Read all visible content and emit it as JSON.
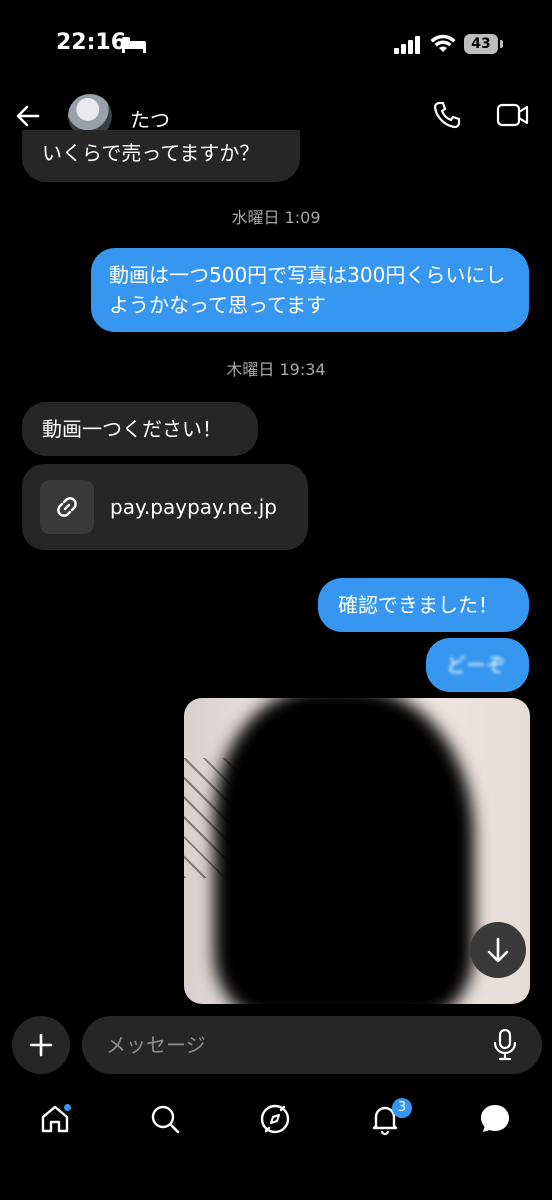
{
  "status_bar": {
    "time": "22:16",
    "battery": "43"
  },
  "header": {
    "contact_name": "たつ"
  },
  "messages": [
    {
      "direction": "in",
      "text": "いくらで売ってますか？"
    },
    {
      "direction": "out",
      "text": "動画は一つ500円で写真は300円くらいにしようかなって思ってます"
    },
    {
      "direction": "in",
      "text": "動画一つください！"
    },
    {
      "direction": "in",
      "type": "link",
      "text": "pay.paypay.ne.jp"
    },
    {
      "direction": "out",
      "text": "確認できました！"
    },
    {
      "direction": "out",
      "text": "どーぞ"
    }
  ],
  "timestamps": [
    "水曜日 1:09",
    "木曜日 19:34"
  ],
  "composer": {
    "placeholder": "メッセージ"
  },
  "tab_bar": {
    "notifications_badge": "3"
  },
  "colors": {
    "accent": "#3797f0",
    "incoming_bubble": "#262626",
    "background": "#000000"
  }
}
